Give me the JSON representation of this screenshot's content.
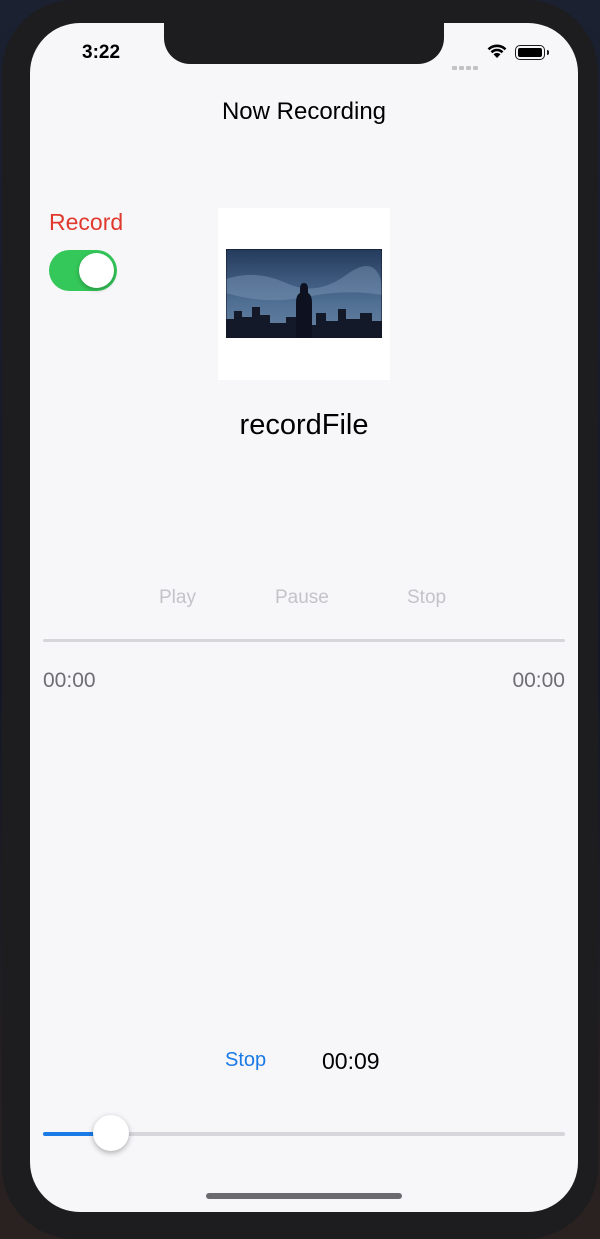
{
  "status_bar": {
    "time": "3:22"
  },
  "nav": {
    "title": "Now Recording"
  },
  "record": {
    "label": "Record",
    "toggle_on": true
  },
  "thumbnail": {
    "description_icon": "photo-thumbnail"
  },
  "file": {
    "name": "recordFile"
  },
  "controls": {
    "play": "Play",
    "pause": "Pause",
    "stop": "Stop"
  },
  "playback": {
    "current_time": "00:00",
    "total_time": "00:00"
  },
  "recording": {
    "stop_label": "Stop",
    "elapsed": "00:09",
    "level": 0.13
  },
  "colors": {
    "accent": "#1a7ae6",
    "record_red": "#e03a2f",
    "toggle_green": "#34c759",
    "disabled_text": "#c4c4c8"
  }
}
